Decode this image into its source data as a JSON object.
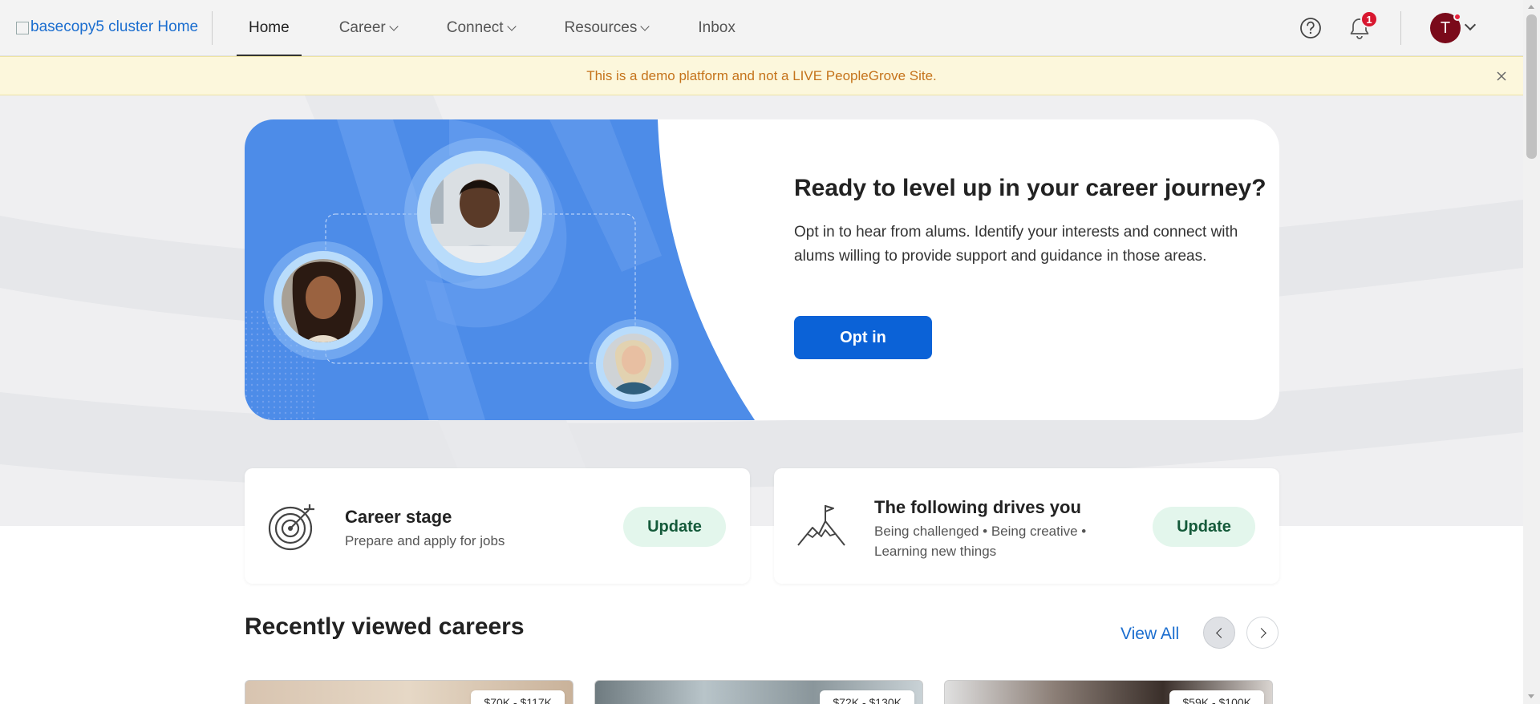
{
  "header": {
    "logo_alt": "basecopy5 cluster Home",
    "nav": [
      {
        "label": "Home",
        "active": true,
        "dropdown": false
      },
      {
        "label": "Career",
        "active": false,
        "dropdown": true
      },
      {
        "label": "Connect",
        "active": false,
        "dropdown": true
      },
      {
        "label": "Resources",
        "active": false,
        "dropdown": true
      },
      {
        "label": "Inbox",
        "active": false,
        "dropdown": false
      }
    ],
    "help_icon": "question-circle-icon",
    "notifications": {
      "icon": "bell-icon",
      "count": "1"
    },
    "avatar": {
      "initial": "T",
      "color": "#7a0a1a"
    }
  },
  "banner": {
    "text": "This is a demo platform and not a LIVE PeopleGrove Site.",
    "close_icon": "close-icon"
  },
  "hero": {
    "title": "Ready to level up in your career journey?",
    "description": "Opt in to hear from alums. Identify your interests and connect with alums willing to provide support and guidance in those areas.",
    "button_label": "Opt in",
    "accent": "#0b62d7"
  },
  "cards": [
    {
      "title": "Career stage",
      "subtitle": "Prepare and apply for jobs",
      "button": "Update",
      "icon": "target-icon"
    },
    {
      "title": "The following drives you",
      "subtitle": "Being challenged • Being creative • Learning new things",
      "button": "Update",
      "icon": "mountain-flag-icon"
    }
  ],
  "recent": {
    "title": "Recently viewed careers",
    "view_all": "View All",
    "careers": [
      {
        "salary": "$70K - $117K"
      },
      {
        "salary": "$72K - $130K"
      },
      {
        "salary": "$59K - $100K"
      }
    ]
  },
  "colors": {
    "link": "#1a6dcf",
    "update_bg": "#e3f6ec",
    "banner_text": "#c5731b",
    "badge": "#d8172f"
  }
}
